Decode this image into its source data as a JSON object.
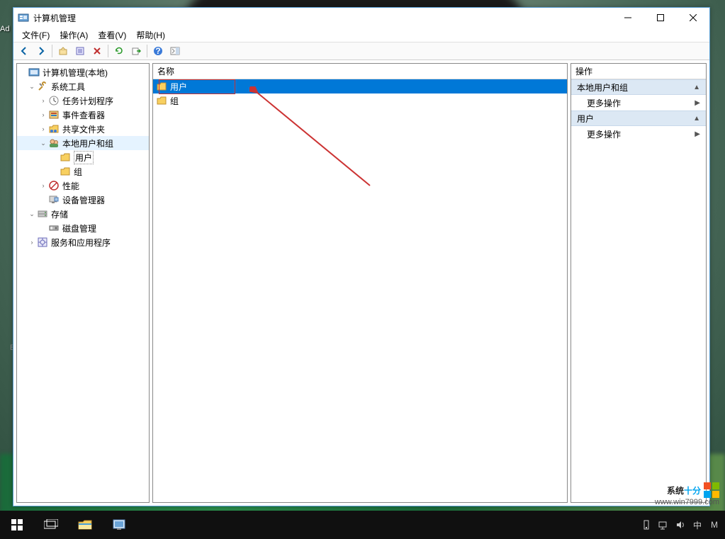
{
  "window": {
    "title": "计算机管理",
    "menu": {
      "file": "文件(F)",
      "action": "操作(A)",
      "view": "查看(V)",
      "help": "帮助(H)"
    }
  },
  "tree": {
    "root": "计算机管理(本地)",
    "sysTools": "系统工具",
    "taskScheduler": "任务计划程序",
    "eventViewer": "事件查看器",
    "sharedFolders": "共享文件夹",
    "localUsersGroups": "本地用户和组",
    "users": "用户",
    "groups": "组",
    "performance": "性能",
    "deviceManager": "设备管理器",
    "storage": "存储",
    "diskManagement": "磁盘管理",
    "servicesApps": "服务和应用程序"
  },
  "list": {
    "headerName": "名称",
    "rowUsers": "用户",
    "rowGroups": "组"
  },
  "actions": {
    "header": "操作",
    "group1": "本地用户和组",
    "more1": "更多操作",
    "group2": "用户",
    "more2": "更多操作"
  },
  "watermark": {
    "brandA": "系统",
    "brandB": "十分",
    "url": "www.win7999.com"
  },
  "edge": {
    "ad": "Ad",
    "e": "E"
  },
  "taskbar": {
    "ime1": "中",
    "ime2": "M"
  }
}
